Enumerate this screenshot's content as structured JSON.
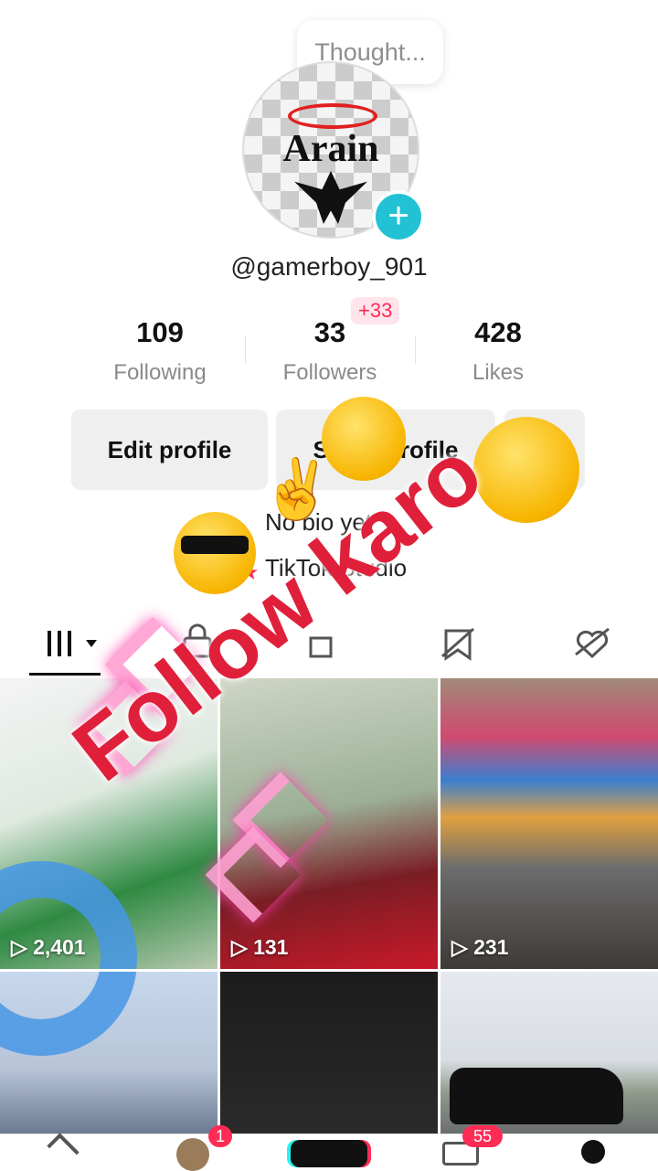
{
  "thought_bubble": "Thought...",
  "avatar_text": "Arain",
  "username": "@gamerboy_901",
  "stats": [
    {
      "value": "109",
      "label": "Following"
    },
    {
      "value": "33",
      "label": "Followers"
    },
    {
      "value": "428",
      "label": "Likes"
    }
  ],
  "followers_delta": "+33",
  "buttons": {
    "edit": "Edit profile",
    "share": "Share profile"
  },
  "bio": "No bio yet",
  "shop": "TikTok Studio",
  "overlay_text": "Follow karo",
  "tabs": [
    "videos-tab",
    "private-tab",
    "reposts-tab",
    "favorites-tab",
    "liked-tab"
  ],
  "videos": [
    {
      "plays": "2,401"
    },
    {
      "plays": "131"
    },
    {
      "plays": "231"
    },
    {
      "plays": ""
    },
    {
      "plays": ""
    },
    {
      "plays": ""
    }
  ],
  "nav_badges": {
    "friends": "1",
    "inbox": "55"
  },
  "colors": {
    "accent": "#fe2c55",
    "teal": "#22c2d4"
  }
}
